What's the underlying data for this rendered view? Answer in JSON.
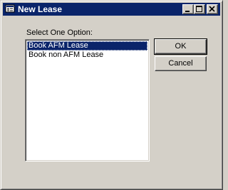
{
  "window": {
    "title": "New Lease"
  },
  "titlebar": {
    "icon": "app-icon",
    "minimize_icon": "minimize-icon",
    "maximize_icon": "maximize-icon",
    "close_icon": "close-icon"
  },
  "dialog": {
    "prompt": "Select One Option:",
    "options": [
      {
        "label": "Book AFM Lease",
        "selected": true
      },
      {
        "label": "Book non AFM Lease",
        "selected": false
      }
    ],
    "ok_label": "OK",
    "cancel_label": "Cancel"
  },
  "colors": {
    "titlebar": "#0a246a",
    "face": "#d4d0c8",
    "selection": "#0a246a"
  }
}
